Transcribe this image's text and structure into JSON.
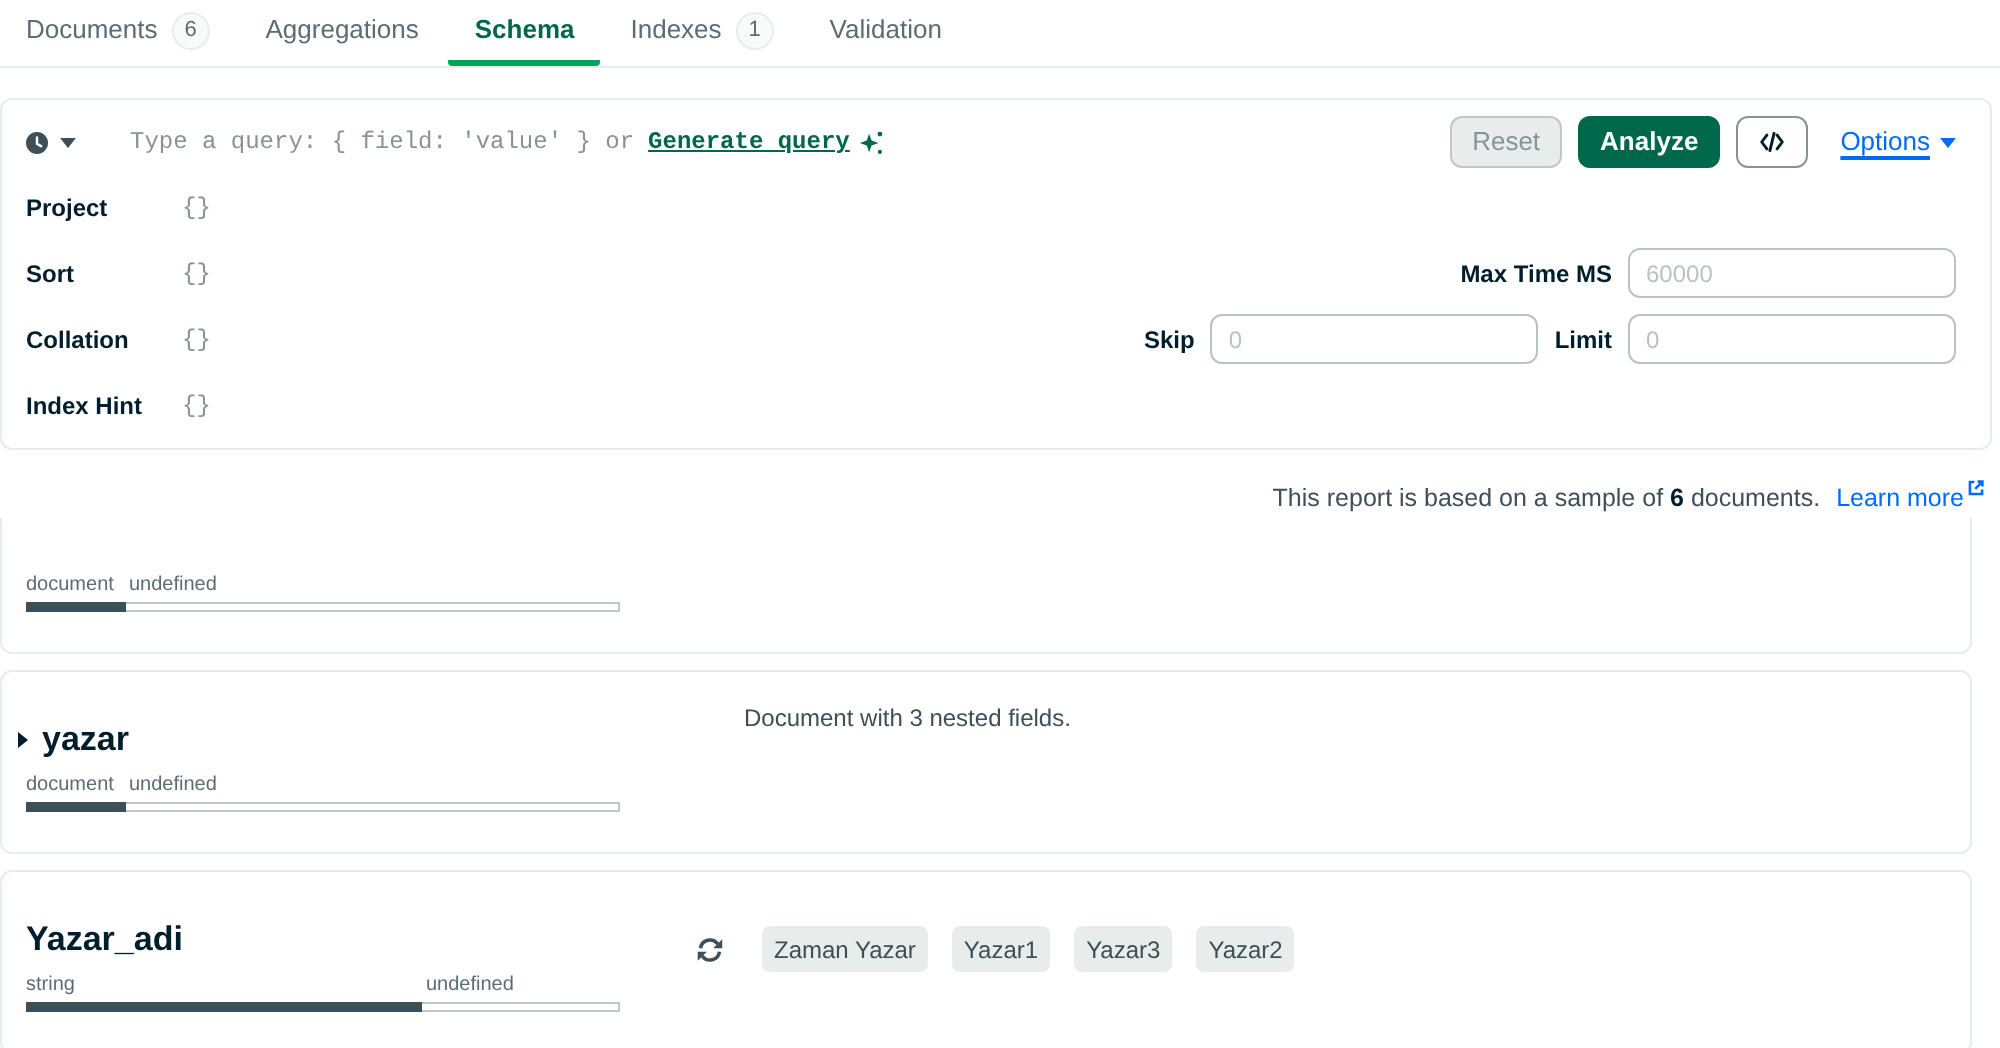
{
  "tabs": [
    {
      "label": "Documents",
      "count": "6",
      "selected": false
    },
    {
      "label": "Aggregations",
      "selected": false
    },
    {
      "label": "Schema",
      "selected": true
    },
    {
      "label": "Indexes",
      "count": "1",
      "selected": false
    },
    {
      "label": "Validation",
      "selected": false
    }
  ],
  "query_bar": {
    "placeholder": "Type a query: { field: 'value' } or",
    "generate_link": "Generate query",
    "buttons": [
      {
        "label": "Reset",
        "kind": "default",
        "disabled": true
      },
      {
        "label": "Analyze",
        "kind": "primary",
        "disabled": false
      }
    ],
    "options_link": "Options",
    "options": [
      {
        "label": "Project",
        "placeholder": "{}"
      },
      {
        "label": "Sort",
        "placeholder": "{}",
        "fields": [
          {
            "label": "Max Time MS",
            "placeholder": "60000"
          }
        ]
      },
      {
        "label": "Collation",
        "placeholder": "{}",
        "fields": [
          {
            "label": "Skip",
            "placeholder": "0"
          },
          {
            "label": "Limit",
            "placeholder": "0"
          }
        ]
      },
      {
        "label": "Index Hint",
        "placeholder": "{}"
      }
    ]
  },
  "sample_note": {
    "text": "This report is based on a sample of **6** documents.",
    "link": "Learn more"
  },
  "schema_fields": [
    {
      "types": [
        "document",
        "undefined"
      ],
      "level": 0.1667
    },
    {
      "name": "yazar",
      "expanded": false,
      "types": [
        "document",
        "undefined"
      ],
      "level": 0.1667,
      "summary": "Document with 3 nested fields."
    },
    {
      "name": "Yazar_adi",
      "types": [
        "string",
        "undefined"
      ],
      "level": 0.6667,
      "values": [
        "Zaman Yazar",
        "Yazar1",
        "Yazar3",
        "Yazar2"
      ]
    }
  ]
}
